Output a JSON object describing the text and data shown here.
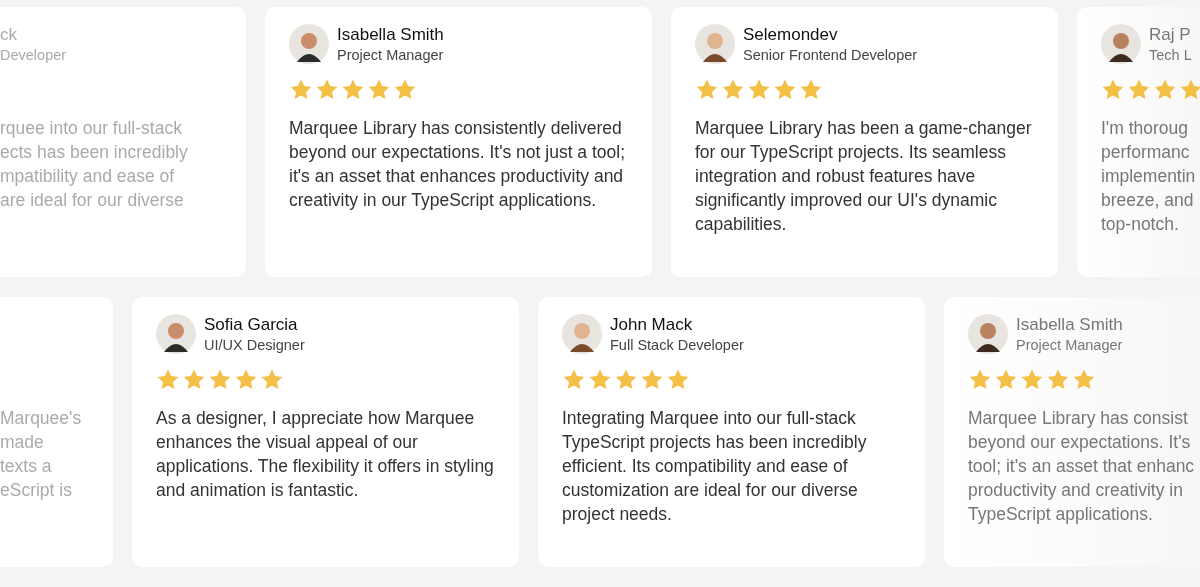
{
  "rows": [
    {
      "cards": [
        {
          "kind": "cut-left",
          "name": "ck",
          "role": "Developer",
          "lines": [
            "rquee into our full-stack",
            "ects has been incredibly",
            "mpatibility and ease of",
            "are ideal for our diverse"
          ]
        },
        {
          "kind": "full",
          "name": "Isabella Smith",
          "role": "Project Manager",
          "stars": 5,
          "text": "Marquee Library has consistently delivered beyond our expectations. It's not just a tool; it's an asset that enhances productivity and creativity in our TypeScript applications."
        },
        {
          "kind": "full",
          "name": "Selemondev",
          "role": "Senior Frontend Developer",
          "stars": 5,
          "text": "Marquee Library has been a game-changer for our TypeScript projects. Its seamless integration and robust features have significantly improved our UI's dynamic capabilities."
        },
        {
          "kind": "cut-right",
          "name": "Raj P",
          "role": "Tech L",
          "stars": 4,
          "lines": [
            "I'm thoroug",
            "performanc",
            "implementin",
            "breeze, and",
            "top-notch."
          ]
        }
      ]
    },
    {
      "cards": [
        {
          "kind": "cut-left",
          "lines": [
            "Marquee's",
            "made",
            "texts a",
            "eScript is"
          ]
        },
        {
          "kind": "full",
          "name": "Sofia Garcia",
          "role": "UI/UX Designer",
          "stars": 5,
          "text": "As a designer, I appreciate how Marquee enhances the visual appeal of our applications. The flexibility it offers in styling and animation is fantastic."
        },
        {
          "kind": "full",
          "name": "John Mack",
          "role": "Full Stack Developer",
          "stars": 5,
          "text": "Integrating Marquee into our full-stack TypeScript projects has been incredibly efficient. Its compatibility and ease of customization are ideal for our diverse project needs."
        },
        {
          "kind": "cut-right",
          "name": "Isabella Smith",
          "role": "Project Manager",
          "stars": 5,
          "lines": [
            "Marquee Library has consist",
            "beyond our expectations. It's",
            "tool; it's an asset that enhanc",
            "productivity and creativity in",
            "TypeScript applications."
          ]
        }
      ]
    }
  ]
}
